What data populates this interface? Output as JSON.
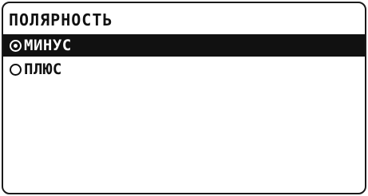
{
  "screen": {
    "title": "ПОЛЯРНОСТЬ"
  },
  "menu": {
    "items": [
      {
        "label": "МИНУС",
        "selected": true
      },
      {
        "label": "ПЛЮС",
        "selected": false
      }
    ]
  }
}
